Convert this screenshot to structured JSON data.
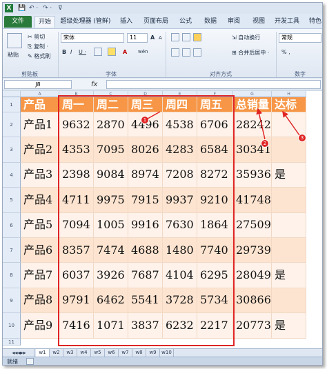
{
  "app": {
    "logo": "X",
    "quick_access": [
      "💾",
      "↶ ·",
      "↷ ·",
      "⊽"
    ]
  },
  "tabs": [
    {
      "label": "文件",
      "type": "file"
    },
    {
      "label": "开始",
      "type": "active"
    },
    {
      "label": "超级处理器 (管鲜)",
      "type": "normal"
    },
    {
      "label": "插入",
      "type": "normal"
    },
    {
      "label": "页面布局",
      "type": "normal"
    },
    {
      "label": "公式",
      "type": "normal"
    },
    {
      "label": "数据",
      "type": "normal"
    },
    {
      "label": "审阅",
      "type": "normal"
    },
    {
      "label": "视图",
      "type": "normal"
    },
    {
      "label": "开发工具",
      "type": "normal"
    },
    {
      "label": "特色",
      "type": "normal"
    }
  ],
  "ribbon": {
    "clipboard": {
      "paste": "粘贴",
      "cut": "剪切",
      "copy": "复制 ·",
      "format_painter": "格式刷",
      "label": "剪贴板"
    },
    "font": {
      "name": "宋体",
      "size": "11",
      "grow": "A",
      "shrink": "A",
      "bold": "B",
      "italic": "I",
      "underline": "U ·",
      "label": "字体",
      "wen": "wén"
    },
    "alignment": {
      "wrap": "自动换行",
      "merge": "合并后居中 ·",
      "label": "对齐方式"
    },
    "number": {
      "format": "常规",
      "percent": "% ,",
      "label": "数字"
    }
  },
  "formula_bar": {
    "name_box": "J8",
    "fx": "fx",
    "value": ""
  },
  "grid": {
    "col_headers": [
      "A",
      "B",
      "C",
      "D",
      "E",
      "F",
      "G",
      "H"
    ],
    "header_row": [
      "产品",
      "周一",
      "周二",
      "周三",
      "周四",
      "周五",
      "总销量",
      "达标"
    ],
    "rows": [
      {
        "num": "2",
        "cells": [
          "产品1",
          "9632",
          "2870",
          "4496",
          "4538",
          "6706",
          "28242",
          ""
        ]
      },
      {
        "num": "3",
        "cells": [
          "产品2",
          "4353",
          "7095",
          "8026",
          "4283",
          "6584",
          "30341",
          ""
        ]
      },
      {
        "num": "4",
        "cells": [
          "产品3",
          "2398",
          "9084",
          "8974",
          "7208",
          "8272",
          "35936",
          "是"
        ]
      },
      {
        "num": "5",
        "cells": [
          "产品4",
          "4711",
          "9975",
          "7915",
          "9937",
          "9210",
          "41748",
          ""
        ]
      },
      {
        "num": "6",
        "cells": [
          "产品5",
          "7094",
          "1005",
          "9916",
          "7630",
          "1864",
          "27509",
          ""
        ]
      },
      {
        "num": "7",
        "cells": [
          "产品6",
          "8357",
          "7474",
          "4688",
          "1480",
          "7740",
          "29739",
          ""
        ]
      },
      {
        "num": "8",
        "cells": [
          "产品7",
          "6037",
          "3926",
          "7687",
          "4104",
          "6295",
          "28049",
          "是"
        ]
      },
      {
        "num": "9",
        "cells": [
          "产品8",
          "9791",
          "6462",
          "5541",
          "3728",
          "5734",
          "30866",
          ""
        ]
      },
      {
        "num": "10",
        "cells": [
          "产品9",
          "7416",
          "1071",
          "3837",
          "6232",
          "2217",
          "20773",
          "是"
        ]
      }
    ],
    "row1_num": "1",
    "row11_num": "11",
    "callouts": [
      "1",
      "2",
      "3"
    ]
  },
  "sheet_tabs": [
    "w1",
    "w2",
    "w3",
    "w4",
    "w5",
    "w6",
    "w7",
    "w8",
    "w9",
    "w10"
  ],
  "status": {
    "ready": "就绪"
  },
  "colors": {
    "header_orange": "#f79646",
    "band_dark": "#fde4d0",
    "band_light": "#fef2ea",
    "annotation_red": "#e02424"
  }
}
